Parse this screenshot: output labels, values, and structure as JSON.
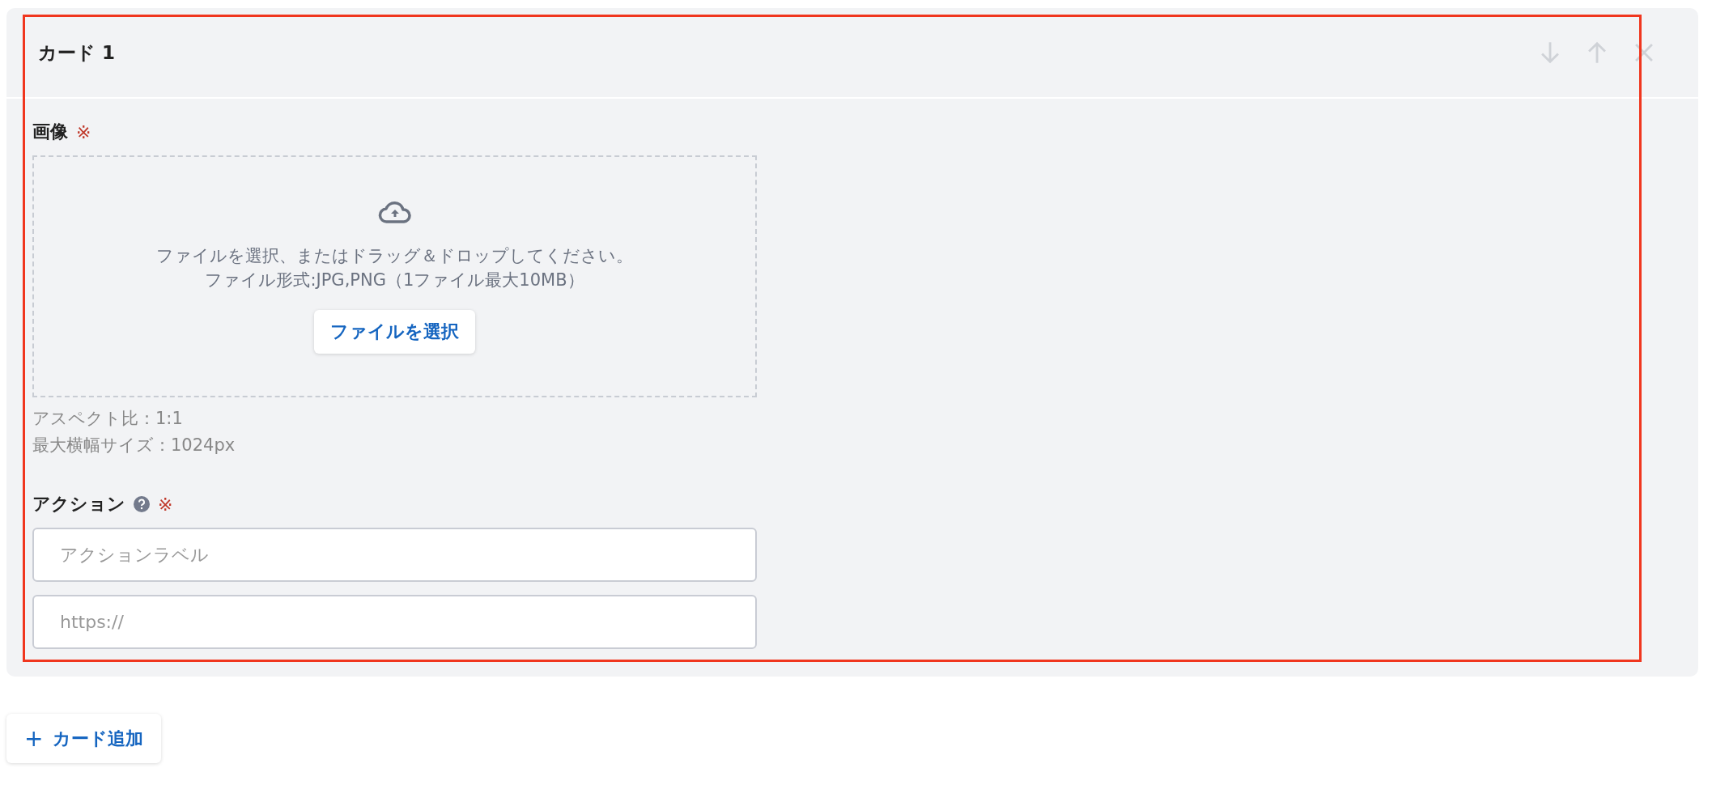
{
  "cards": [
    {
      "title": "カード 1",
      "highlighted": true,
      "controls": [
        {
          "kind": "down"
        },
        {
          "kind": "up"
        },
        {
          "kind": "remove"
        }
      ],
      "image_field": {
        "label": "画像",
        "required_mark": "※",
        "dropzone": {
          "instruction": "ファイルを選択、またはドラッグ＆ドロップしてください。",
          "formats": "ファイル形式:JPG,PNG（1ファイル最大10MB）",
          "button": "ファイルを選択"
        },
        "notes": [
          "アスペクト比：1:1",
          "最大横幅サイズ：1024px"
        ]
      },
      "action_field": {
        "label": "アクション",
        "help": true,
        "required_mark": "※",
        "inputs": [
          {
            "placeholder": "アクションラベル"
          },
          {
            "placeholder": "https://"
          }
        ]
      }
    }
  ],
  "add_button": {
    "icon": "+",
    "label": "カード追加"
  }
}
